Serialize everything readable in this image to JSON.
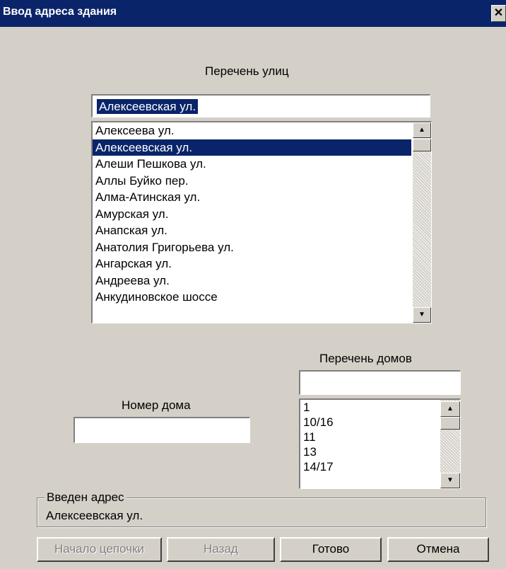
{
  "window": {
    "title": "Ввод адреса здания",
    "close_glyph": "✕"
  },
  "street_section": {
    "label": "Перечень улиц",
    "input_value": "Алексеевская ул.",
    "items": [
      "Алексеева ул.",
      "Алексеевская ул.",
      "Алеши Пешкова ул.",
      "Аллы Буйко пер.",
      "Алма-Атинская ул.",
      "Амурская ул.",
      "Анапская ул.",
      "Анатолия Григорьева ул.",
      "Ангарская ул.",
      "Андреева ул.",
      "Анкудиновское шоссе"
    ],
    "selected_index": 1
  },
  "house_section": {
    "label": "Перечень домов",
    "input_value": "",
    "items": [
      "1",
      "10/16",
      "11",
      "13",
      "14/17"
    ]
  },
  "house_number": {
    "label": "Номер дома",
    "value": ""
  },
  "entered_address": {
    "label": "Введен  адрес",
    "value": "Алексеевская ул."
  },
  "buttons": {
    "chain_start": "Начало цепочки",
    "back": "Назад",
    "done": "Готово",
    "cancel": "Отмена"
  },
  "icons": {
    "scroll_up": "arrow-up-icon",
    "scroll_down": "arrow-down-icon",
    "close": "close-icon"
  },
  "colors": {
    "titlebar": "#0a246a",
    "selection": "#0a246a",
    "face": "#d4d0c8"
  }
}
